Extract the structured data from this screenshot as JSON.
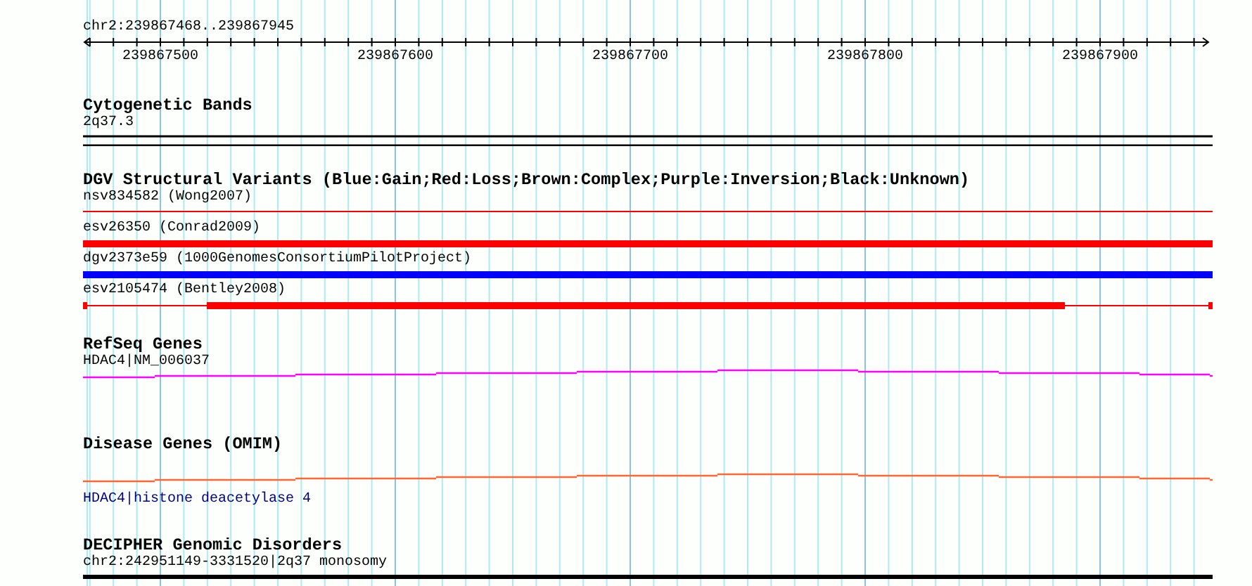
{
  "ruler": {
    "range": "chr2:239867468..239867945",
    "tick_labels": [
      "239867500",
      "239867600",
      "239867700",
      "239867800",
      "239867900"
    ]
  },
  "tracks": [
    {
      "title": "Cytogenetic Bands",
      "features": [
        {
          "label": "2q37.3",
          "kind": "band",
          "color": "#000000"
        }
      ]
    },
    {
      "title": "DGV Structural Variants (Blue:Gain;Red:Loss;Brown:Complex;Purple:Inversion;Black:Unknown)",
      "features": [
        {
          "label": "nsv834582 (Wong2007)",
          "kind": "thin",
          "color": "#ff0000"
        },
        {
          "label": "esv26350 (Conrad2009)",
          "kind": "thick",
          "color": "#ff0000"
        },
        {
          "label": "dgv2373e59 (1000GenomesConsortiumPilotProject)",
          "kind": "thick",
          "color": "#0000ff"
        },
        {
          "label": "esv2105474 (Bentley2008)",
          "kind": "partial",
          "color": "#ff0000"
        }
      ]
    },
    {
      "title": "RefSeq Genes",
      "features": [
        {
          "label": "HDAC4|NM_006037",
          "kind": "gene",
          "color": "#ff00ff"
        }
      ]
    },
    {
      "title": "Disease Genes (OMIM)",
      "features": [
        {
          "label": "HDAC4|histone deacetylase 4",
          "kind": "gene_label_below",
          "color": "#ff6633"
        }
      ]
    },
    {
      "title": "DECIPHER Genomic Disorders",
      "features": [
        {
          "label": "chr2:242951149-3331520|2q37 monosomy",
          "kind": "heavy",
          "color": "#000000"
        }
      ]
    }
  ]
}
